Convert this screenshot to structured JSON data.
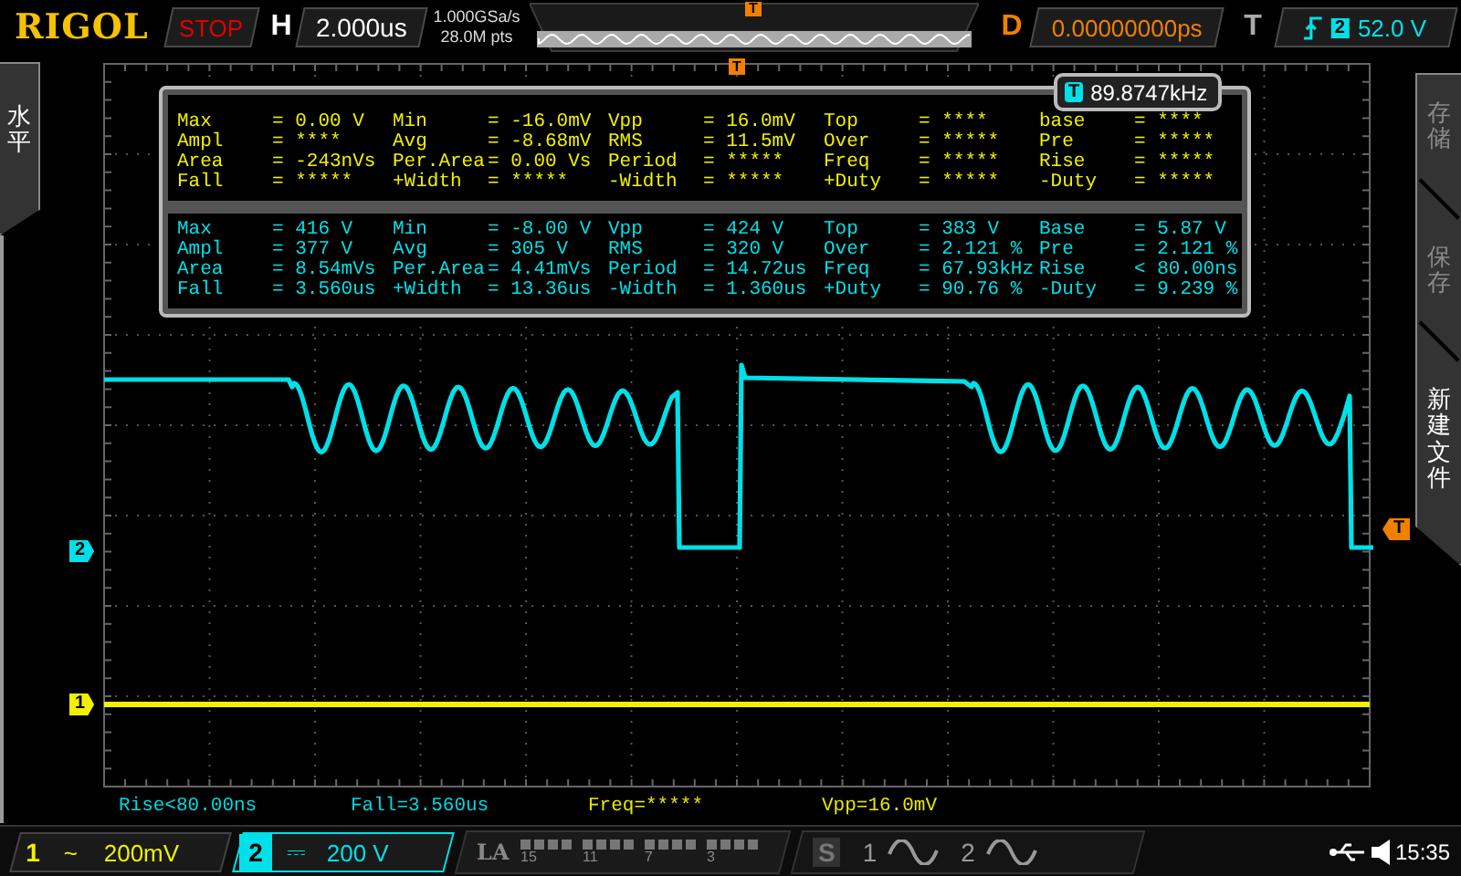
{
  "top_bar": {
    "logo": "RIGOL",
    "run_state": "STOP",
    "timebase_label": "H",
    "timebase": "2.000us",
    "sample_rate": "1.000GSa/s",
    "memory_depth": "28.0M pts",
    "overview_marker": "T",
    "delay_label": "D",
    "delay": "0.00000000ps",
    "trigger_label": "T",
    "trigger_source": "2",
    "trigger_level": "52.0 V"
  },
  "left_menu": {
    "title": "水平"
  },
  "right_menu": {
    "items": [
      {
        "label": "存储",
        "disabled": true
      },
      {
        "label": "保存",
        "disabled": true
      },
      {
        "label": "新建文件",
        "disabled": false
      }
    ]
  },
  "display": {
    "trigger_position_marker": "T",
    "trigger_level_marker": "T",
    "channel_markers": [
      {
        "label": "2",
        "color": "#00e0e8"
      },
      {
        "label": "1",
        "color": "#f0f000"
      }
    ],
    "counter": {
      "icon_label": "T",
      "value": "89.8747kHz"
    },
    "measurements": [
      {
        "color": "#f0f000",
        "items": [
          {
            "name": "Max",
            "value": "= 0.00 V"
          },
          {
            "name": "Min",
            "value": "= -16.0mV"
          },
          {
            "name": "Vpp",
            "value": "= 16.0mV"
          },
          {
            "name": "Top",
            "value": "= ****"
          },
          {
            "name": "base",
            "value": "= ****"
          },
          {
            "name": "Ampl",
            "value": "= ****"
          },
          {
            "name": "Avg",
            "value": "= -8.68mV"
          },
          {
            "name": "RMS",
            "value": "= 11.5mV"
          },
          {
            "name": "Over",
            "value": "= *****"
          },
          {
            "name": "Pre",
            "value": "= *****"
          },
          {
            "name": "Area",
            "value": "= -243nVs"
          },
          {
            "name": "Per.Area",
            "value": "= 0.00 Vs"
          },
          {
            "name": "Period",
            "value": "= *****"
          },
          {
            "name": "Freq",
            "value": "= *****"
          },
          {
            "name": "Rise",
            "value": "= *****"
          },
          {
            "name": "Fall",
            "value": "= *****"
          },
          {
            "name": "+Width",
            "value": "= *****"
          },
          {
            "name": "-Width",
            "value": "= *****"
          },
          {
            "name": "+Duty",
            "value": "= *****"
          },
          {
            "name": "-Duty",
            "value": "= *****"
          }
        ]
      },
      {
        "color": "#00e0e8",
        "items": [
          {
            "name": "Max",
            "value": "= 416 V"
          },
          {
            "name": "Min",
            "value": "= -8.00 V"
          },
          {
            "name": "Vpp",
            "value": "= 424 V"
          },
          {
            "name": "Top",
            "value": "= 383 V"
          },
          {
            "name": "Base",
            "value": "= 5.87 V"
          },
          {
            "name": "Ampl",
            "value": "= 377 V"
          },
          {
            "name": "Avg",
            "value": "= 305 V"
          },
          {
            "name": "RMS",
            "value": "= 320 V"
          },
          {
            "name": "Over",
            "value": "= 2.121 %"
          },
          {
            "name": "Pre",
            "value": "= 2.121 %"
          },
          {
            "name": "Area",
            "value": "= 8.54mVs"
          },
          {
            "name": "Per.Area",
            "value": "= 4.41mVs"
          },
          {
            "name": "Period",
            "value": "= 14.72us"
          },
          {
            "name": "Freq",
            "value": "= 67.93kHz"
          },
          {
            "name": "Rise",
            "value": "< 80.00ns"
          },
          {
            "name": "Fall",
            "value": "= 3.560us"
          },
          {
            "name": "+Width",
            "value": "= 13.36us"
          },
          {
            "name": "-Width",
            "value": "= 1.360us"
          },
          {
            "name": "+Duty",
            "value": "= 90.76 %"
          },
          {
            "name": "-Duty",
            "value": "= 9.239 %"
          }
        ]
      }
    ],
    "bottom_readouts": [
      {
        "text": "Rise<80.00ns",
        "color": "#00d8e0"
      },
      {
        "text": "Fall=3.560us",
        "color": "#00d8e0"
      },
      {
        "text": "Freq=*****",
        "color": "#e8e800"
      },
      {
        "text": "Vpp=16.0mV",
        "color": "#e8e800"
      }
    ]
  },
  "status_bar": {
    "channels": [
      {
        "number": "1",
        "coupling": "~",
        "scale": "200mV",
        "selected": false,
        "color": "#f0f000"
      },
      {
        "number": "2",
        "coupling": "⎓",
        "scale": "200 V",
        "selected": true,
        "color": "#00e0e8"
      }
    ],
    "logic": {
      "label": "LA",
      "groups": [
        "15",
        "11",
        "7",
        "3"
      ]
    },
    "serial": {
      "label": "S",
      "buses": [
        "1",
        "2"
      ]
    },
    "time": "15:35"
  }
}
